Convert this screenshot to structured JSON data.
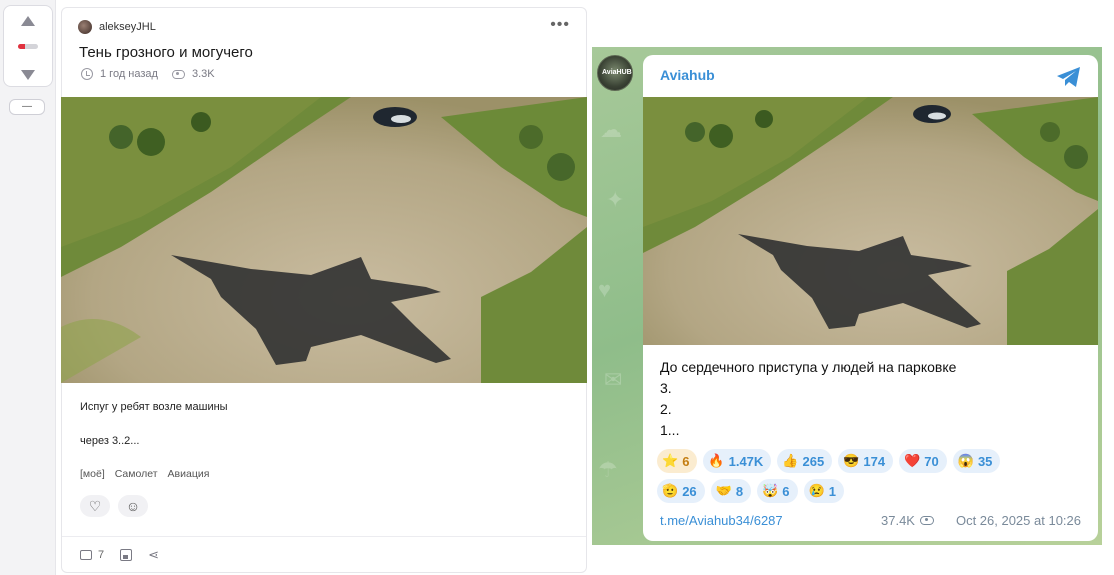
{
  "vote": {
    "collapse_label": "—",
    "rating_fraction": 0.35,
    "colors": {
      "negative": "#e0323f",
      "neutral": "#d4d4d9"
    }
  },
  "post": {
    "author": "alekseyJHL",
    "more_icon": "•••",
    "title": "Тень грозного и могучего",
    "time": "1 год назад",
    "views": "3.3K",
    "body_line1": "Испуг у ребят возле машины",
    "body_line2": "через 3..2...",
    "tags": [
      "[моё]",
      "Самолет",
      "Авиация"
    ],
    "heart_icon": "♡",
    "emoji_icon": "☺",
    "comments_count": "7",
    "share_icon": "⋖"
  },
  "telegram": {
    "avatar_text": "AviaHUB",
    "channel": "Aviahub",
    "accent": "#3a8fd6",
    "lines": [
      "До сердечного приступа у людей на парковке",
      "3.",
      "2.",
      "1..."
    ],
    "reactions": [
      [
        {
          "emoji": "⭐",
          "count": "6",
          "star": true
        },
        {
          "emoji": "🔥",
          "count": "1.47K"
        },
        {
          "emoji": "👍",
          "count": "265"
        },
        {
          "emoji": "😎",
          "count": "174"
        },
        {
          "emoji": "❤️",
          "count": "70"
        },
        {
          "emoji": "😱",
          "count": "35"
        }
      ],
      [
        {
          "emoji": "🫡",
          "count": "26"
        },
        {
          "emoji": "🤝",
          "count": "8"
        },
        {
          "emoji": "🤯",
          "count": "6"
        },
        {
          "emoji": "😢",
          "count": "1"
        }
      ]
    ],
    "link": "t.me/Aviahub34/6287",
    "views": "37.4K",
    "date": "Oct 26, 2025 at 10:26"
  }
}
